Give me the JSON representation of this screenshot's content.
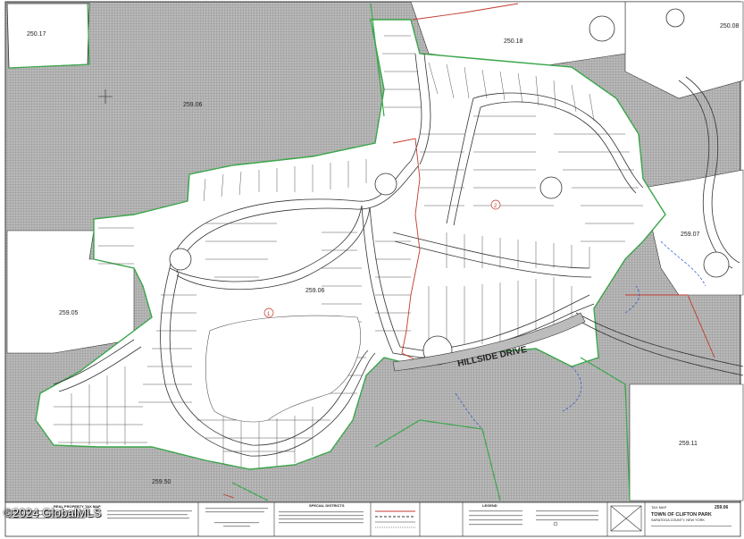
{
  "map": {
    "parcel_labels": {
      "p25006": "259.06",
      "p25017": "250.17",
      "p25018": "250.18",
      "p25008": "250.08",
      "p25907": "259.07",
      "p25905": "259.05",
      "p25911": "259.11",
      "p25950": "259.50",
      "p25906b": "259.06"
    },
    "street_label": "HILLSIDE DRIVE",
    "area_markers": [
      "1",
      "2"
    ]
  },
  "legend": {
    "left_title": "REAL PROPERTY TAX MAP",
    "special_districts_title": "SPECIAL DISTRICTS",
    "legend_title": "LEGEND"
  },
  "title_block": {
    "tax_map": "TAX MAP",
    "sheet_number": "259.06",
    "town": "TOWN OF CLIFTON PARK",
    "county": "SARATOGA COUNTY, NEW YORK"
  },
  "watermark": "©2024 GlobalMLS",
  "colors": {
    "hatch": "#9a9a9a",
    "subdivision_boundary": "#3aa64a",
    "district_line": "#c0392b",
    "stream": "#2255cc"
  }
}
